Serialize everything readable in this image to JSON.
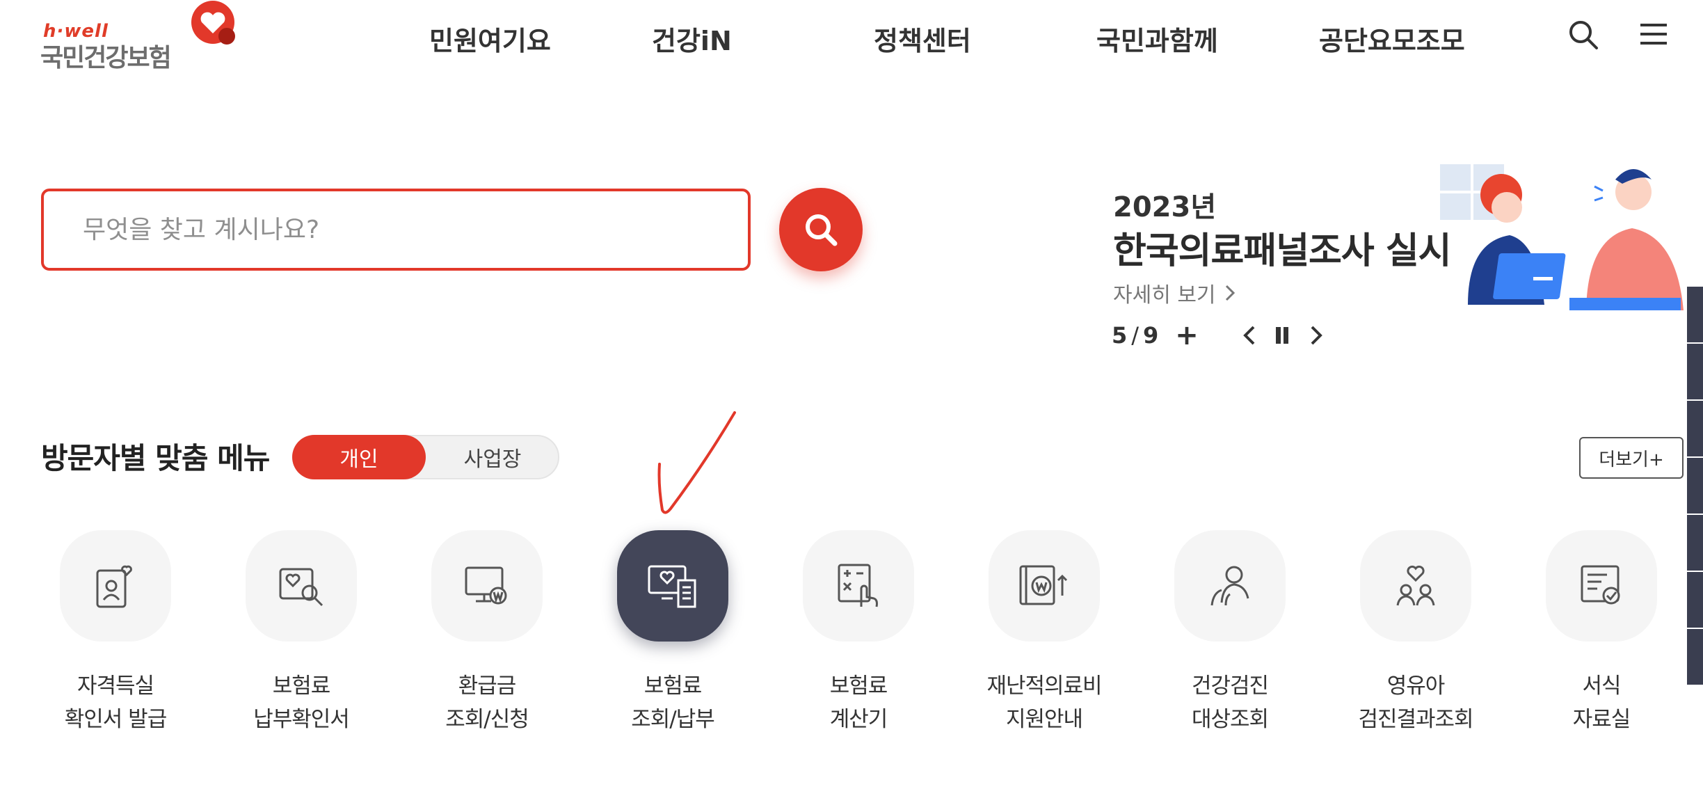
{
  "header": {
    "logo_sub": "h·well",
    "logo_main": "국민건강보험",
    "nav": [
      "민원여기요",
      "건강iN",
      "정책센터",
      "국민과함께",
      "공단요모조모"
    ],
    "icons": [
      "search-icon",
      "hamburger-menu-icon"
    ]
  },
  "search": {
    "placeholder": "무엇을 찾고 계시나요?",
    "value": ""
  },
  "banner": {
    "year": "2023년",
    "title": "한국의료패널조사 실시",
    "more_label": "자세히 보기",
    "current": "5",
    "separator": "/",
    "total": "9",
    "plus_label": "+"
  },
  "visitor_menu": {
    "title": "방문자별 맞춤 메뉴",
    "tabs": [
      "개인",
      "사업장"
    ],
    "active_tab": "개인",
    "more_label": "더보기+",
    "items": [
      {
        "line1": "자격득실",
        "line2": "확인서 발급",
        "icon": "certificate-icon"
      },
      {
        "line1": "보험료",
        "line2": "납부확인서",
        "icon": "document-search-icon"
      },
      {
        "line1": "환급금",
        "line2": "조회/신청",
        "icon": "monitor-won-icon"
      },
      {
        "line1": "보험료",
        "line2": "조회/납부",
        "icon": "monitor-receipt-icon"
      },
      {
        "line1": "보험료",
        "line2": "계산기",
        "icon": "calculator-icon"
      },
      {
        "line1": "재난적의료비",
        "line2": "지원안내",
        "icon": "book-won-icon"
      },
      {
        "line1": "건강검진",
        "line2": "대상조회",
        "icon": "people-icon"
      },
      {
        "line1": "영유아",
        "line2": "검진결과조회",
        "icon": "family-heart-icon"
      },
      {
        "line1": "서식",
        "line2": "자료실",
        "icon": "form-check-icon"
      }
    ]
  },
  "colors": {
    "accent": "#e2382a",
    "active_icon_bg": "#434659",
    "icon_bg": "#f5f5f5"
  }
}
